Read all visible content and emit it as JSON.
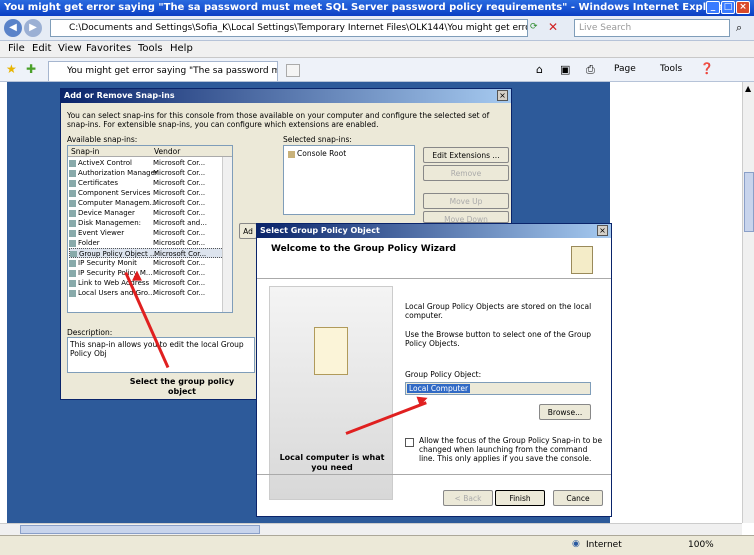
{
  "window": {
    "title": "You might get error saying \"The sa password must meet SQL Server password policy requirements\" - Windows Internet Explorer"
  },
  "browser": {
    "address": "C:\\Documents and Settings\\Sofia_K\\Local Settings\\Temporary Internet Files\\OLK144\\You might get error saying The sa p",
    "search_placeholder": "Live Search",
    "menu": [
      "File",
      "Edit",
      "View",
      "Favorites",
      "Tools",
      "Help"
    ],
    "tab_title": "You might get error saying \"The sa password must me...",
    "toolbar": {
      "page": "Page",
      "tools": "Tools"
    },
    "status_zone": "Internet",
    "zoom": "100%"
  },
  "snapin_dialog": {
    "title": "Add or Remove Snap-ins",
    "intro": "You can select snap-ins for this console from those available on your computer and configure the selected set of snap-ins. For extensible snap-ins, you can configure which extensions are enabled.",
    "available_label": "Available snap-ins:",
    "selected_label": "Selected snap-ins:",
    "col_snapin": "Snap-in",
    "col_vendor": "Vendor",
    "rows": [
      {
        "name": "ActiveX Control",
        "vendor": "Microsoft Cor..."
      },
      {
        "name": "Authorization Manager",
        "vendor": "Microsoft Cor..."
      },
      {
        "name": "Certificates",
        "vendor": "Microsoft Cor..."
      },
      {
        "name": "Component Services",
        "vendor": "Microsoft Cor..."
      },
      {
        "name": "Computer Managem...",
        "vendor": "Microsoft Cor..."
      },
      {
        "name": "Device Manager",
        "vendor": "Microsoft Cor..."
      },
      {
        "name": "Disk Managemen:",
        "vendor": "Microsoft and..."
      },
      {
        "name": "Event Viewer",
        "vendor": "Microsoft Cor..."
      },
      {
        "name": "Folder",
        "vendor": "Microsoft Cor..."
      },
      {
        "name": "Group Policy Object ...",
        "vendor": "Microsoft Cor..."
      },
      {
        "name": "IP Security Monit",
        "vendor": "Microsoft Cor..."
      },
      {
        "name": "IP Security Policy M...",
        "vendor": "Microsoft Cor..."
      },
      {
        "name": "Link to Web Address",
        "vendor": "Microsoft Cor..."
      },
      {
        "name": "Local Users and Gro...",
        "vendor": "Microsoft Cor..."
      }
    ],
    "selected_item": "Console Root",
    "btn_edit_ext": "Edit Extensions ...",
    "btn_remove": "Remove",
    "btn_move_up": "Move Up",
    "btn_move_down": "Move Down",
    "btn_add": "Ad",
    "description_label": "Description:",
    "description": "This snap-in allows you to edit the local Group Policy Obj",
    "annotation": "Select the group policy object"
  },
  "gpo_wizard": {
    "title": "Select Group Policy Object",
    "heading": "Welcome to the Group Policy Wizard",
    "text1": "Local Group Policy Objects are stored on the local computer.",
    "text2": "Use the Browse button to select one of the Group Policy Objects.",
    "gpo_label": "Group Policy Object:",
    "gpo_value": "Local Computer",
    "btn_browse": "Browse...",
    "checkbox_label": "Allow the focus of the Group Policy Snap-in to be changed when launching from the command line. This only applies if you save the console.",
    "annotation": "Local computer is what you need",
    "btn_back": "< Back",
    "btn_finish": "Finish",
    "btn_cancel": "Cance"
  }
}
